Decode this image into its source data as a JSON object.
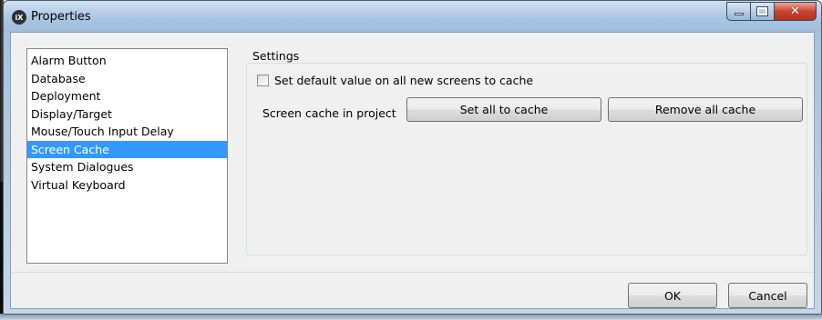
{
  "window": {
    "app_icon_text": "iX",
    "title": "Properties"
  },
  "nav": {
    "items": [
      {
        "label": "Alarm Button",
        "selected": false
      },
      {
        "label": "Database",
        "selected": false
      },
      {
        "label": "Deployment",
        "selected": false
      },
      {
        "label": "Display/Target",
        "selected": false
      },
      {
        "label": "Mouse/Touch Input Delay",
        "selected": false
      },
      {
        "label": "Screen Cache",
        "selected": true
      },
      {
        "label": "System Dialogues",
        "selected": false
      },
      {
        "label": "Virtual Keyboard",
        "selected": false
      }
    ]
  },
  "settings": {
    "group_label": "Settings",
    "default_cache_checkbox": {
      "label": "Set default value on all new screens to cache",
      "checked": false
    },
    "cache_row_label": "Screen cache in project",
    "set_all_button": "Set all to cache",
    "remove_all_button": "Remove all cache"
  },
  "footer": {
    "ok_label": "OK",
    "cancel_label": "Cancel"
  },
  "colors": {
    "selection": "#3399ff",
    "client_bg": "#f0f0f0",
    "close_button": "#c7442f"
  }
}
